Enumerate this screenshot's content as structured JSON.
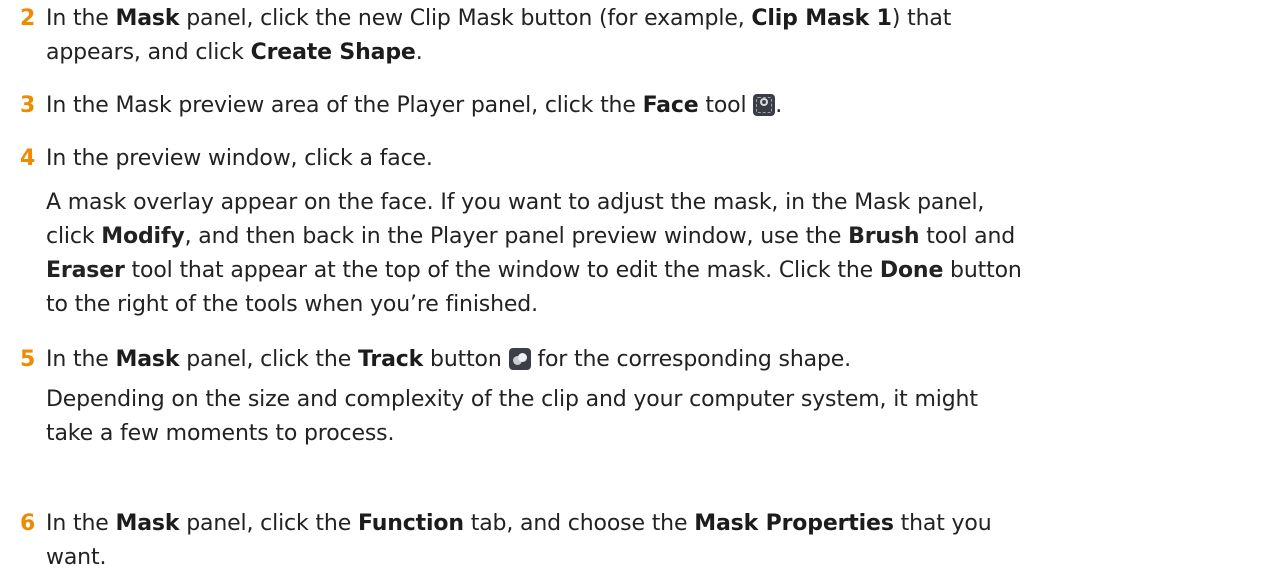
{
  "steps": [
    {
      "number": "2",
      "lines": [
        {
          "t1": "In the ",
          "b1": "Mask",
          "t2": " panel, click the new Clip Mask button (for example, ",
          "b2": "Clip Mask 1",
          "t3": ") that"
        },
        {
          "t1": "appears, and click ",
          "b1": "Create Shape",
          "t2": "."
        }
      ]
    },
    {
      "number": "3",
      "t1": "In the Mask preview area of the Player panel, click the ",
      "b1": "Face",
      "t2": " tool ",
      "icon": "face-tool-icon",
      "t3": "."
    },
    {
      "number": "4",
      "main": "In the preview window, click a face.",
      "detail": [
        {
          "t1": "A mask overlay appear on the face. If you want to adjust the mask, in the Mask panel,"
        },
        {
          "t1": "click ",
          "b1": "Modify",
          "t2": ", and then back in the Player panel preview window, use the ",
          "b2": "Brush",
          "t3": " tool and"
        },
        {
          "b1": "Eraser",
          "t1": " tool that appear at the top of the window to edit the mask. Click the ",
          "b2": "Done",
          "t2": " button"
        },
        {
          "t1": "to the right of the tools when you’re finished."
        }
      ]
    },
    {
      "number": "5",
      "t1": "In the ",
      "b1": "Mask",
      "t2": " panel, click the ",
      "b2": "Track",
      "t3": " button ",
      "icon": "track-icon",
      "t4": " for the corresponding shape.",
      "detail": [
        "Depending on the size and complexity of the clip and your computer system, it might",
        "take a few moments to process."
      ]
    },
    {
      "number": "6",
      "lines": [
        {
          "t1": "In the ",
          "b1": "Mask",
          "t2": " panel, click the ",
          "b2": "Function",
          "t3": " tab, and choose the ",
          "b3": "Mask Properties",
          "t4": " that you"
        },
        {
          "t1": "want."
        }
      ]
    }
  ]
}
